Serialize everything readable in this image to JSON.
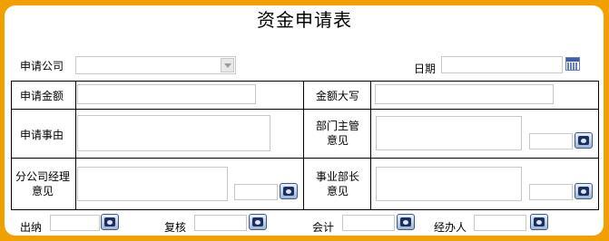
{
  "form": {
    "title": "资金申请表",
    "company_label": "申请公司",
    "company_value": "",
    "date_label": "日期",
    "date_value": "",
    "amount_label": "申请金额",
    "amount_value": "",
    "amount_upper_label": "金额大写",
    "amount_upper_value": "",
    "reason_label": "申请事由",
    "reason_value": "",
    "dept_head_label_1": "部门主管",
    "dept_head_label_2": "意见",
    "dept_head_value": "",
    "branch_mgr_label_1": "分公司经理",
    "branch_mgr_label_2": "意见",
    "branch_mgr_value": "",
    "biz_head_label_1": "事业部长",
    "biz_head_label_2": "意见",
    "biz_head_value": "",
    "cashier_label": "出纳",
    "review_label": "复核",
    "accounting_label": "会计",
    "handler_label": "经办人"
  },
  "icons": {
    "date_picker": "calendar-icon",
    "user_picker": "user-picker-icon"
  },
  "colors": {
    "frame": "#f0a000",
    "panel": "#ffffff",
    "input_border": "#c8c8c8"
  }
}
